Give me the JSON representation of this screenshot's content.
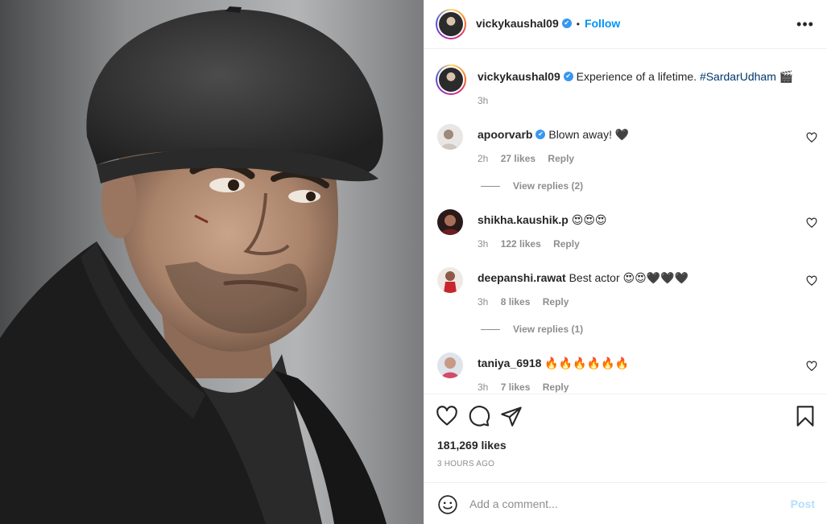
{
  "post": {
    "username": "vickykaushal09",
    "follow_label": "Follow",
    "separator": "•",
    "more_label": "•••",
    "verified_mark": "✔",
    "caption": "Experience of a lifetime. ",
    "hashtag": "#SardarUdham",
    "caption_emoji": "🎬",
    "caption_time": "3h",
    "likes": "181,269 likes",
    "time_ago": "3 HOURS AGO"
  },
  "comments": [
    {
      "username": "apoorvarb",
      "verified": true,
      "text": "Blown away! 🖤",
      "time": "2h",
      "likes": "27 likes",
      "reply": "Reply",
      "view_replies": "View replies (2)",
      "avatar": "avatar-apoorvarb"
    },
    {
      "username": "shikha.kaushik.p",
      "verified": false,
      "text": "😍😍😍",
      "time": "3h",
      "likes": "122 likes",
      "reply": "Reply",
      "view_replies": "",
      "avatar": "avatar-shikha"
    },
    {
      "username": "deepanshi.rawat",
      "verified": false,
      "text": "Best actor 😍😍🖤🖤🖤",
      "time": "3h",
      "likes": "8 likes",
      "reply": "Reply",
      "view_replies": "View replies (1)",
      "avatar": "avatar-deepanshi"
    },
    {
      "username": "taniya_6918",
      "verified": false,
      "text": "🔥🔥🔥🔥🔥🔥",
      "time": "3h",
      "likes": "7 likes",
      "reply": "Reply",
      "view_replies": "",
      "avatar": "avatar-taniya"
    }
  ],
  "add_comment": {
    "placeholder": "Add a comment...",
    "post_label": "Post"
  },
  "icons": {
    "like": "heart-icon",
    "comment": "comment-icon",
    "share": "share-icon",
    "save": "bookmark-icon",
    "emoji": "emoji-icon",
    "more": "more-options-icon"
  },
  "colors": {
    "follow": "#0095f6",
    "hashtag": "#00376b",
    "muted": "#8e8e8e",
    "post_disabled": "#b2dffc",
    "verified": "#3897f0"
  }
}
